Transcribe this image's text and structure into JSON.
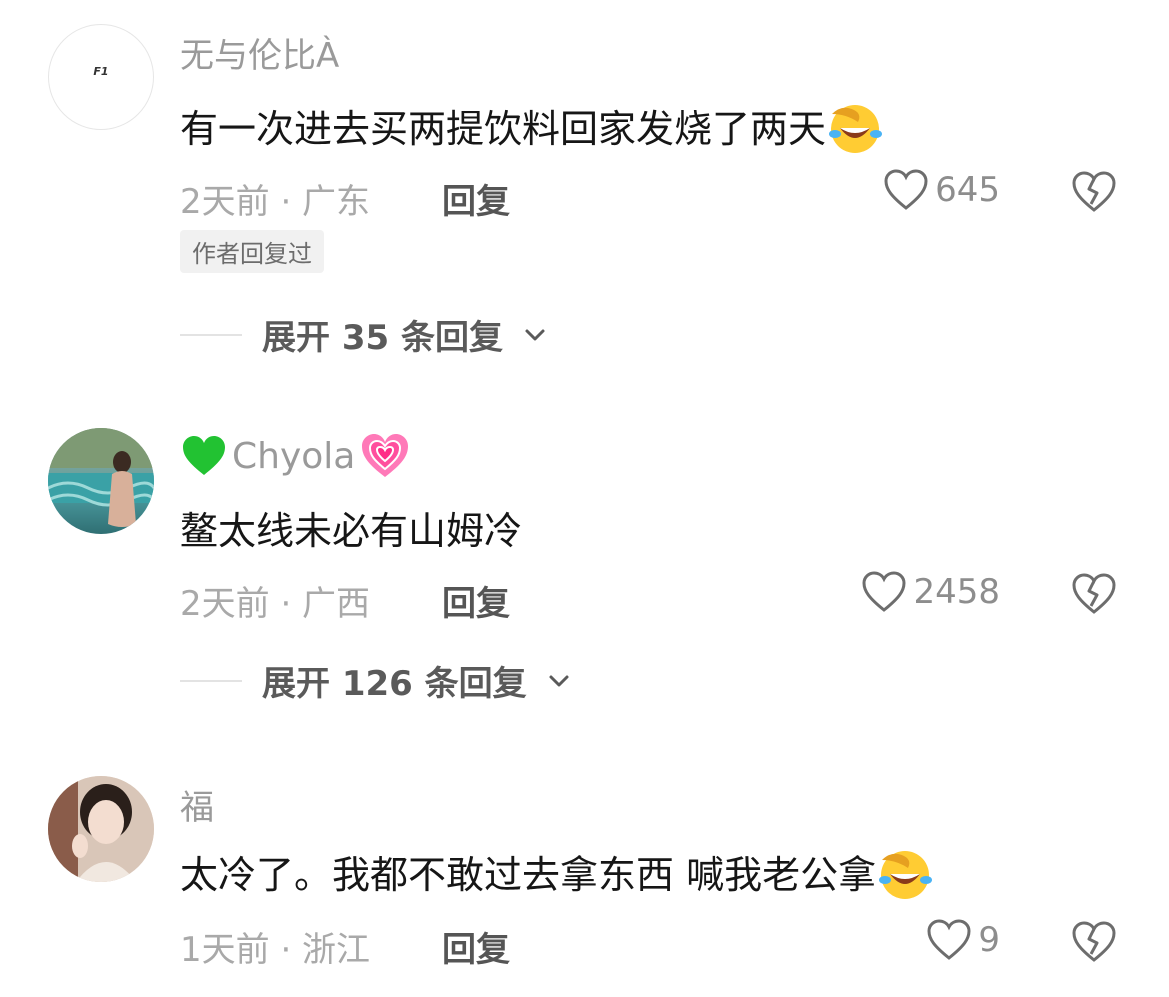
{
  "comments": [
    {
      "username": "无与伦比À",
      "avatar_text": "F1",
      "text": "有一次进去买两提饮料回家发烧了两天",
      "meta": "2天前 · 广东",
      "reply_label": "回复",
      "likes": "645",
      "badge": "作者回复过",
      "expand_label": "展开 35 条回复",
      "trailing_emoji": "laughing-tears-emoji"
    },
    {
      "username": "Chyola",
      "text": "鳌太线未必有山姆冷",
      "meta": "2天前 · 广西",
      "reply_label": "回复",
      "likes": "2458",
      "expand_label": "展开 126 条回复"
    },
    {
      "username": "福",
      "text": "太冷了。我都不敢过去拿东西  喊我老公拿",
      "meta": "1天前 · 浙江",
      "reply_label": "回复",
      "likes": "9",
      "trailing_emoji": "laughing-tears-emoji"
    }
  ],
  "colors": {
    "username": "#9a9a9a",
    "text": "#161616",
    "meta": "#a9a9a9",
    "green_heart": "#22c232",
    "pink_heart": "#ff6fb0"
  }
}
